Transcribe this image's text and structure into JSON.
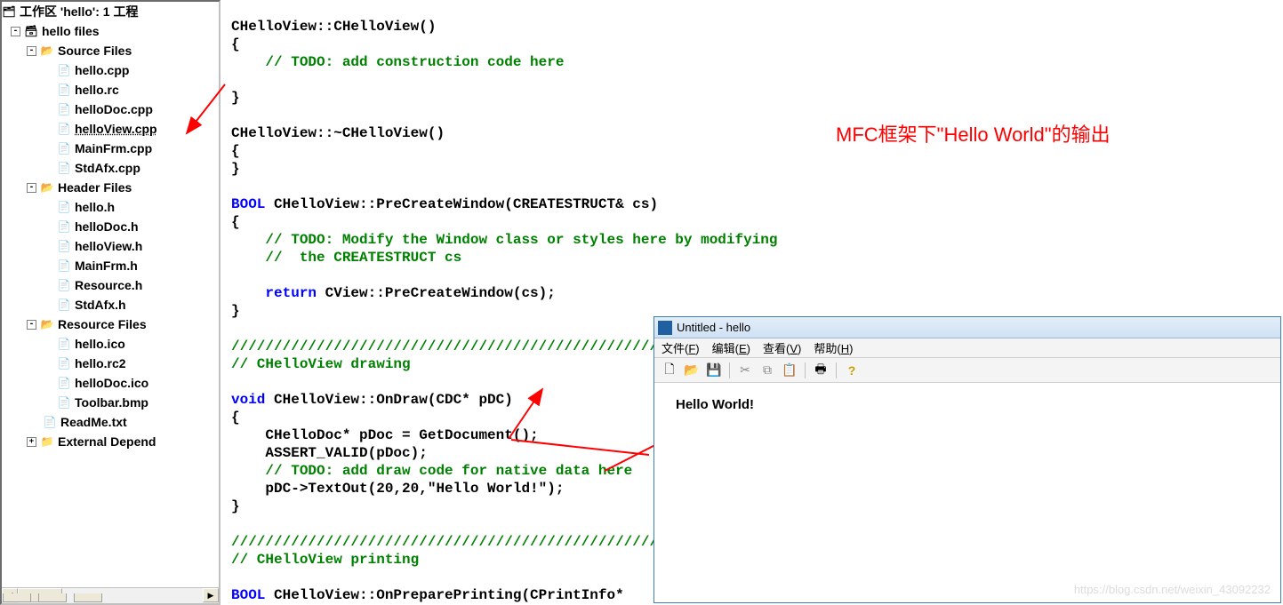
{
  "workspace": {
    "root": "工作区 'hello': 1 工程",
    "project": "hello files",
    "folders": {
      "source": {
        "label": "Source Files",
        "files": [
          "hello.cpp",
          "hello.rc",
          "helloDoc.cpp",
          "helloView.cpp",
          "MainFrm.cpp",
          "StdAfx.cpp"
        ],
        "selected": "helloView.cpp"
      },
      "header": {
        "label": "Header Files",
        "files": [
          "hello.h",
          "helloDoc.h",
          "helloView.h",
          "MainFrm.h",
          "Resource.h",
          "StdAfx.h"
        ]
      },
      "resource": {
        "label": "Resource Files",
        "files": [
          "hello.ico",
          "hello.rc2",
          "helloDoc.ico",
          "Toolbar.bmp"
        ]
      },
      "readme": "ReadMe.txt",
      "external": "External Depend"
    }
  },
  "code": {
    "l1": "CHelloView::CHelloView()",
    "l2": "{",
    "l3": "// TODO: add construction code here",
    "l4": "}",
    "l5": "CHelloView::~CHelloView()",
    "l6": "{",
    "l7": "}",
    "l8p1": "BOOL",
    "l8p2": " CHelloView::PreCreateWindow(CREATESTRUCT& cs)",
    "l9": "{",
    "l10": "// TODO: Modify the Window class or styles here by modifying",
    "l11": "//  the CREATESTRUCT cs",
    "l12p1": "return",
    "l12p2": " CView::PreCreateWindow(cs);",
    "l13": "}",
    "l14": "/////////////////////////////////////////////////////////////////////////////",
    "l15": "// CHelloView drawing",
    "l16p1": "void",
    "l16p2": " CHelloView::OnDraw(CDC* pDC)",
    "l17": "{",
    "l18": "CHelloDoc* pDoc = GetDocument();",
    "l19": "ASSERT_VALID(pDoc);",
    "l20": "// TODO: add draw code for native data here",
    "l21": "pDC->TextOut(20,20,\"Hello World!\");",
    "l22": "}",
    "l23": "/////////////////////////////////////////////////////////////////////////////",
    "l24": "// CHelloView printing",
    "l25p1": "BOOL",
    "l25p2": " CHelloView::OnPreparePrinting(CPrintInfo*"
  },
  "annotation": "MFC框架下\"Hello World\"的输出",
  "app": {
    "title": "Untitled - hello",
    "menus": {
      "file": "文件(F)",
      "edit": "编辑(E)",
      "view": "查看(V)",
      "help": "帮助(H)"
    },
    "client_text": "Hello World!"
  },
  "watermark": "https://blog.csdn.net/weixin_43092232"
}
